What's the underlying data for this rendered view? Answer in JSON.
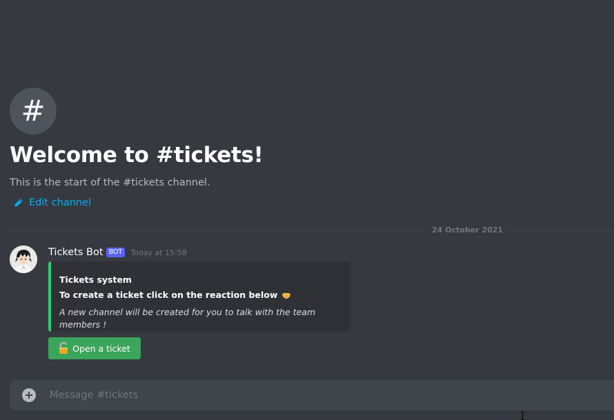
{
  "welcome": {
    "icon": "hash-icon",
    "title": "Welcome to #tickets!",
    "subtitle": "This is the start of the #tickets channel.",
    "edit_channel_label": "Edit channel"
  },
  "divider": {
    "date": "24 October 2021"
  },
  "message": {
    "username": "Tickets Bot",
    "bot_tag": "BOT",
    "timestamp": "Today at 15:58",
    "embed": {
      "accent_color": "#2ecc71",
      "title": "Tickets system",
      "instruction": "To create a ticket click on the reaction below",
      "instruction_icon": "handshake-emoji",
      "description": "A new channel will be created for you to talk with the team members !"
    },
    "button": {
      "icon": "unlock-emoji",
      "label": "Open a ticket",
      "color": "#3ba55c"
    }
  },
  "composer": {
    "placeholder": "Message #tickets"
  }
}
